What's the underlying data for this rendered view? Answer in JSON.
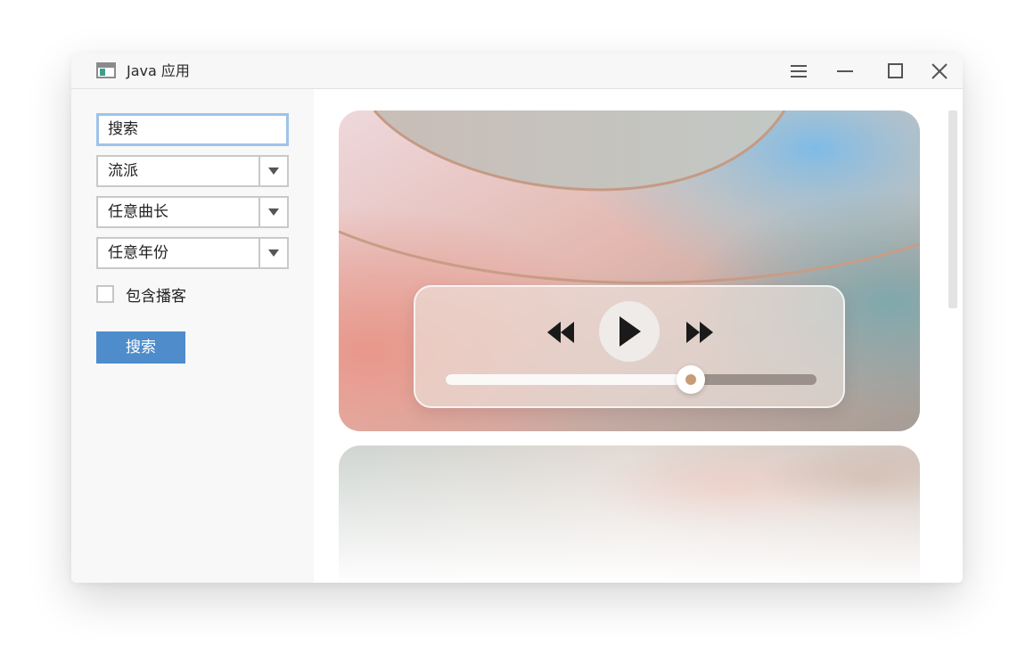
{
  "window": {
    "title": "Java 应用"
  },
  "sidebar": {
    "search_value": "搜索",
    "genre_select": "流派",
    "length_select": "任意曲长",
    "year_select": "任意年份",
    "include_podcasts_label": "包含播客",
    "include_podcasts_checked": false,
    "search_button_label": "搜索"
  },
  "player": {
    "progress_fraction": 0.66
  },
  "colors": {
    "accent": "#4f8ccb",
    "focus_ring": "#9dc3ea",
    "thumb_dot": "#c79d76"
  },
  "icons": [
    "app-window-icon",
    "menu-icon",
    "minimize-icon",
    "maximize-icon",
    "close-icon",
    "dropdown-arrow-icon",
    "rewind-icon",
    "play-icon",
    "fast-forward-icon"
  ]
}
